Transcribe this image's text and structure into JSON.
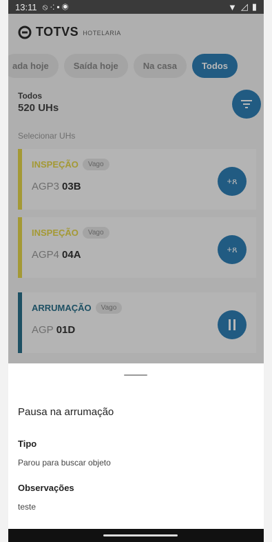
{
  "status_bar": {
    "time": "13:11"
  },
  "app": {
    "brand": "TOTVS",
    "brand_sub": "HOTELARIA"
  },
  "filters": [
    {
      "label": "ada hoje"
    },
    {
      "label": "Saída hoje"
    },
    {
      "label": "Na casa"
    },
    {
      "label": "Todos",
      "active": true
    }
  ],
  "summary": {
    "label": "Todos",
    "count": "520 UHs"
  },
  "select_label": "Selecionar UHs",
  "cards": [
    {
      "status": "INSPEÇÃO",
      "badge": "Vago",
      "prefix": "AGP3",
      "room": "03B",
      "action": "+ጸ",
      "color": "#e3d44a"
    },
    {
      "status": "INSPEÇÃO",
      "badge": "Vago",
      "prefix": "AGP4",
      "room": "04A",
      "action": "+ጸ",
      "color": "#e3d44a"
    },
    {
      "status": "ARRUMAÇÃO",
      "badge": "Vago",
      "prefix": "AGP",
      "room": "01D",
      "action": "pause",
      "color": "#2a6f8a"
    }
  ],
  "sheet": {
    "title": "Pausa na arrumação",
    "tipo_label": "Tipo",
    "tipo_value": "Parou para buscar objeto",
    "obs_label": "Observações",
    "obs_value": "teste"
  },
  "colors": {
    "primary": "#2f7fb4",
    "inspection": "#e3d44a",
    "cleaning": "#2a6f8a"
  }
}
